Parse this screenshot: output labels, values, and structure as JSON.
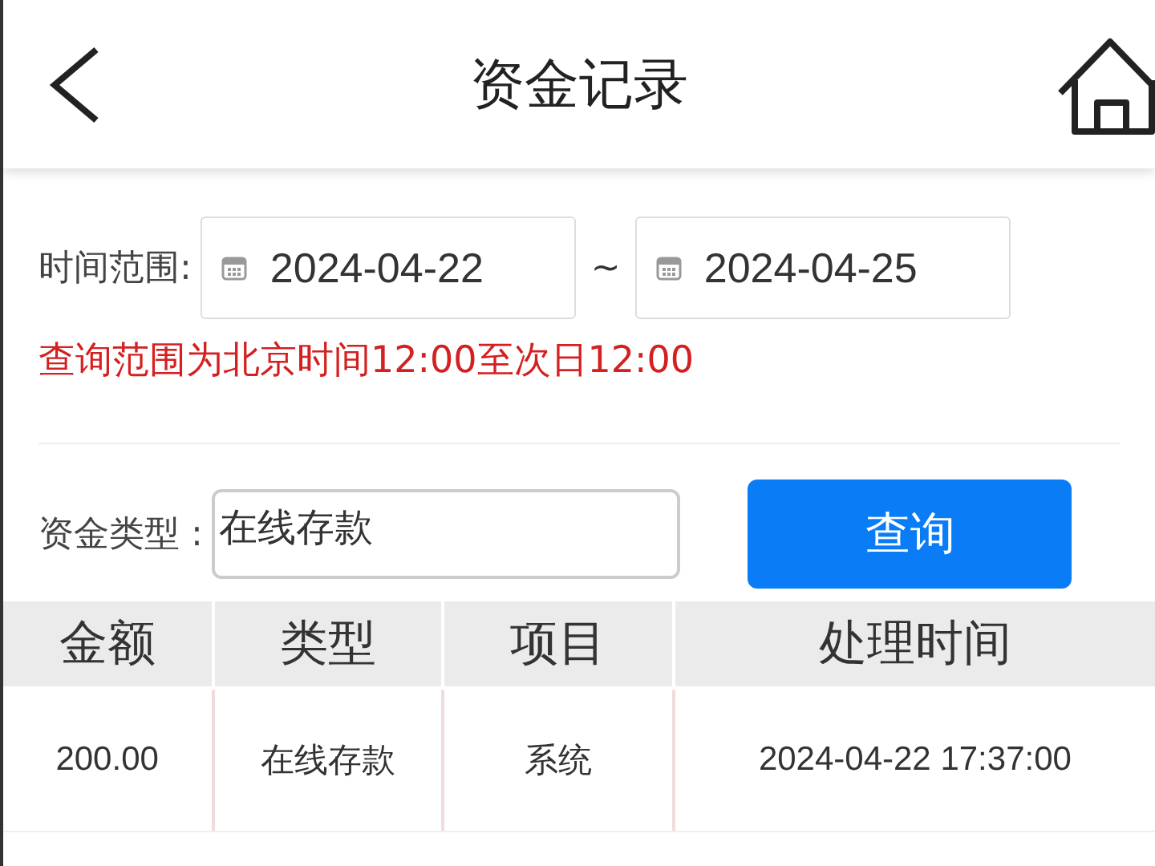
{
  "header": {
    "title": "资金记录"
  },
  "date_range": {
    "label": "时间范围:",
    "start": "2024-04-22",
    "separator": "~",
    "end": "2024-04-25",
    "note": "查询范围为北京时间12:00至次日12:00"
  },
  "fund_type": {
    "label": "资金类型 :",
    "value": "在线存款"
  },
  "query_button": "查询",
  "table": {
    "columns": [
      "金额",
      "类型",
      "项目",
      "处理时间"
    ],
    "rows": [
      [
        "200.00",
        "在线存款",
        "系统",
        "2024-04-22 17:37:00"
      ]
    ]
  }
}
